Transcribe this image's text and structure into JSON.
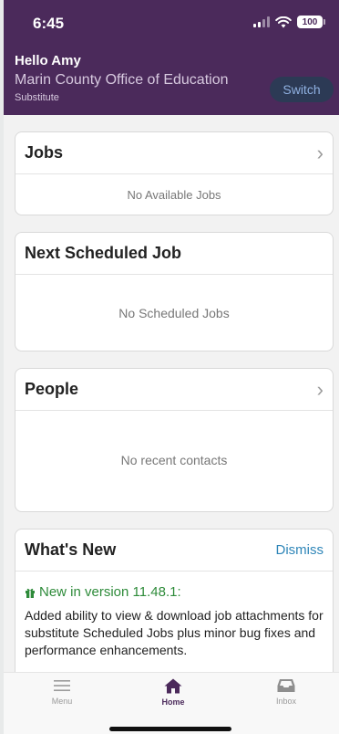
{
  "status": {
    "time": "6:45",
    "battery": "100"
  },
  "header": {
    "greeting": "Hello Amy",
    "organization": "Marin County Office of Education",
    "role": "Substitute",
    "switch_label": "Switch"
  },
  "cards": {
    "jobs": {
      "title": "Jobs",
      "empty": "No Available Jobs"
    },
    "next_job": {
      "title": "Next Scheduled Job",
      "empty": "No Scheduled Jobs"
    },
    "people": {
      "title": "People",
      "empty": "No recent contacts"
    },
    "whats_new": {
      "title": "What's New",
      "dismiss_label": "Dismiss",
      "version_label": "New in version 11.48.1:",
      "body": "Added ability to view & download job attachments for substitute Scheduled Jobs plus minor bug fixes and performance enhancements."
    }
  },
  "tabs": [
    {
      "label": "Menu",
      "icon": "menu-icon"
    },
    {
      "label": "Home",
      "icon": "home-icon",
      "active": true
    },
    {
      "label": "Inbox",
      "icon": "inbox-icon"
    }
  ],
  "colors": {
    "header": "#4b2a5b",
    "accent_blue": "#2f86b8",
    "accent_green": "#2e8b3a"
  }
}
